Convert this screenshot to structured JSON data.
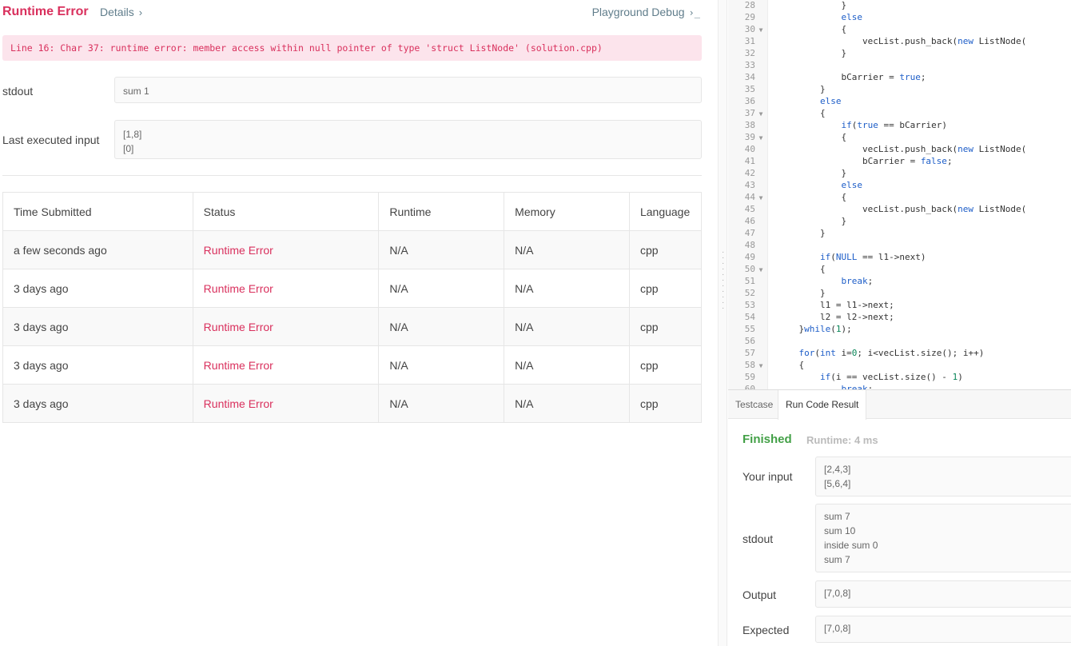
{
  "header": {
    "title": "Runtime Error",
    "details_label": "Details",
    "details_chevron": "›",
    "debug_label": "Playground Debug",
    "debug_icon": "›_"
  },
  "error_message": "Line 16: Char 37: runtime error: member access within null pointer of type 'struct ListNode' (solution.cpp)",
  "stdout": {
    "label": "stdout",
    "value": "sum 1"
  },
  "last_input": {
    "label": "Last executed input",
    "lines": [
      "[1,8]",
      "[0]"
    ]
  },
  "submissions": {
    "headers": [
      "Time Submitted",
      "Status",
      "Runtime",
      "Memory",
      "Language"
    ],
    "rows": [
      [
        "a few seconds ago",
        "Runtime Error",
        "N/A",
        "N/A",
        "cpp"
      ],
      [
        "3 days ago",
        "Runtime Error",
        "N/A",
        "N/A",
        "cpp"
      ],
      [
        "3 days ago",
        "Runtime Error",
        "N/A",
        "N/A",
        "cpp"
      ],
      [
        "3 days ago",
        "Runtime Error",
        "N/A",
        "N/A",
        "cpp"
      ],
      [
        "3 days ago",
        "Runtime Error",
        "N/A",
        "N/A",
        "cpp"
      ]
    ]
  },
  "editor": {
    "lines": [
      {
        "n": "28",
        "fold": false,
        "code": "            }"
      },
      {
        "n": "29",
        "fold": false,
        "code": "            <k>else</k>"
      },
      {
        "n": "30",
        "fold": true,
        "code": "            {"
      },
      {
        "n": "31",
        "fold": false,
        "code": "                vecList.push_back(<k>new</k> ListNode("
      },
      {
        "n": "32",
        "fold": false,
        "code": "            }"
      },
      {
        "n": "33",
        "fold": false,
        "code": ""
      },
      {
        "n": "34",
        "fold": false,
        "code": "            bCarrier = <k>true</k>;"
      },
      {
        "n": "35",
        "fold": false,
        "code": "        }"
      },
      {
        "n": "36",
        "fold": false,
        "code": "        <k>else</k>"
      },
      {
        "n": "37",
        "fold": true,
        "code": "        {"
      },
      {
        "n": "38",
        "fold": false,
        "code": "            <k>if</k>(<k>true</k> == bCarrier)"
      },
      {
        "n": "39",
        "fold": true,
        "code": "            {"
      },
      {
        "n": "40",
        "fold": false,
        "code": "                vecList.push_back(<k>new</k> ListNode("
      },
      {
        "n": "41",
        "fold": false,
        "code": "                bCarrier = <k>false</k>;"
      },
      {
        "n": "42",
        "fold": false,
        "code": "            }"
      },
      {
        "n": "43",
        "fold": false,
        "code": "            <k>else</k>"
      },
      {
        "n": "44",
        "fold": true,
        "code": "            {"
      },
      {
        "n": "45",
        "fold": false,
        "code": "                vecList.push_back(<k>new</k> ListNode("
      },
      {
        "n": "46",
        "fold": false,
        "code": "            }"
      },
      {
        "n": "47",
        "fold": false,
        "code": "        }"
      },
      {
        "n": "48",
        "fold": false,
        "code": ""
      },
      {
        "n": "49",
        "fold": false,
        "code": "        <k>if</k>(<k>NULL</k> == l1->next)"
      },
      {
        "n": "50",
        "fold": true,
        "code": "        {"
      },
      {
        "n": "51",
        "fold": false,
        "code": "            <k>break</k>;"
      },
      {
        "n": "52",
        "fold": false,
        "code": "        }"
      },
      {
        "n": "53",
        "fold": false,
        "code": "        l1 = l1->next;"
      },
      {
        "n": "54",
        "fold": false,
        "code": "        l2 = l2->next;"
      },
      {
        "n": "55",
        "fold": false,
        "code": "    }<k>while</k>(<m>1</m>);"
      },
      {
        "n": "56",
        "fold": false,
        "code": ""
      },
      {
        "n": "57",
        "fold": false,
        "code": "    <k>for</k>(<k>int</k> i=<m>0</m>; i<vecList.size(); i++)"
      },
      {
        "n": "58",
        "fold": true,
        "code": "    {"
      },
      {
        "n": "59",
        "fold": false,
        "code": "        <k>if</k>(i == vecList.size() - <m>1</m>)"
      },
      {
        "n": "60",
        "fold": false,
        "code": "            <k>break</k>;"
      }
    ]
  },
  "result": {
    "tabs": [
      "Testcase",
      "Run Code Result"
    ],
    "active_tab": 1,
    "status": "Finished",
    "runtime": "Runtime: 4 ms",
    "input_label": "Your input",
    "input_lines": [
      "[2,4,3]",
      "[5,6,4]"
    ],
    "stdout_label": "stdout",
    "stdout_lines": [
      "sum 7",
      "sum 10",
      "inside sum 0",
      "sum 7"
    ],
    "output_label": "Output",
    "output_value": "[7,0,8]",
    "expected_label": "Expected",
    "expected_value": "[7,0,8]"
  },
  "colors": {
    "error": "#d9305d",
    "success": "#43a047",
    "muted": "#607d8b",
    "keyword": "#1e5ec8"
  }
}
